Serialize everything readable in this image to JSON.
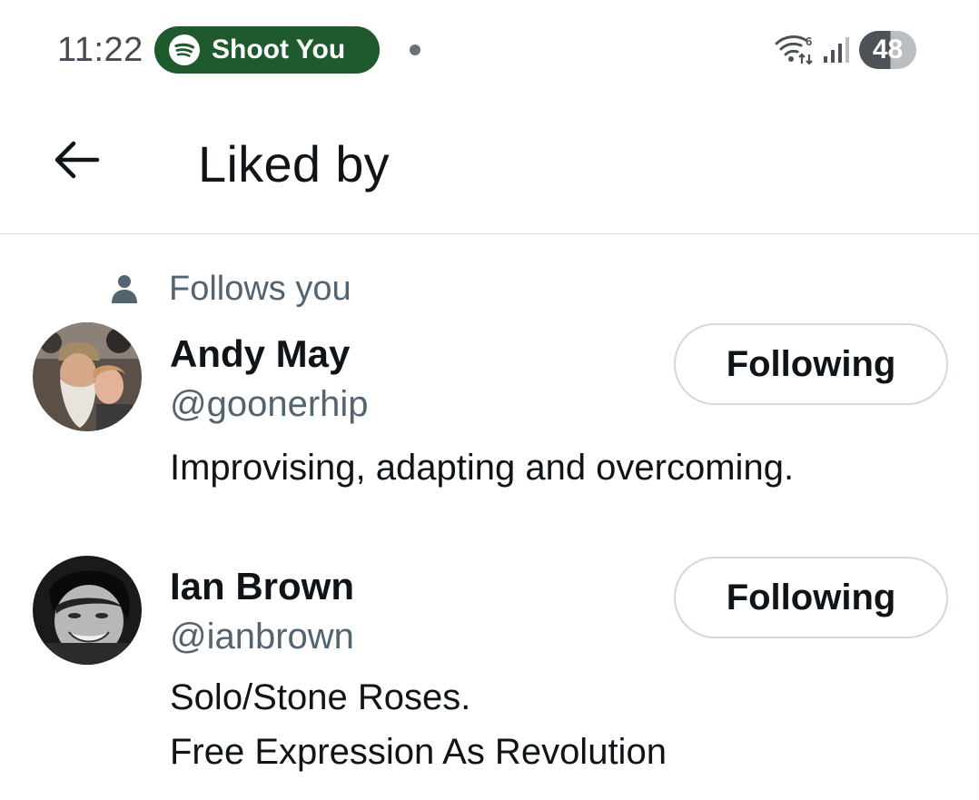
{
  "status_bar": {
    "time": "11:22",
    "media_app_icon": "spotify-icon",
    "media_text": "Shoot You",
    "wifi_icon": "wifi-6-icon",
    "signal_icon": "cellular-signal-icon",
    "battery_level": "48"
  },
  "header": {
    "back_icon": "arrow-left-icon",
    "title": "Liked by"
  },
  "users": [
    {
      "context_icon": "person-icon",
      "context_text": "Follows you",
      "name": "Andy May",
      "handle": "@goonerhip",
      "bio_lines": [
        "Improvising, adapting and overcoming."
      ],
      "button_label": "Following"
    },
    {
      "name": "Ian Brown",
      "handle": "@ianbrown",
      "bio_lines": [
        "Solo/Stone Roses.",
        "Free Expression As Revolution"
      ],
      "button_label": "Following"
    }
  ],
  "colors": {
    "text_primary": "#0f1419",
    "text_secondary": "#536471",
    "button_border": "#cfd9de",
    "media_pill": "#1f5a2e",
    "divider": "#dfe3e6"
  }
}
